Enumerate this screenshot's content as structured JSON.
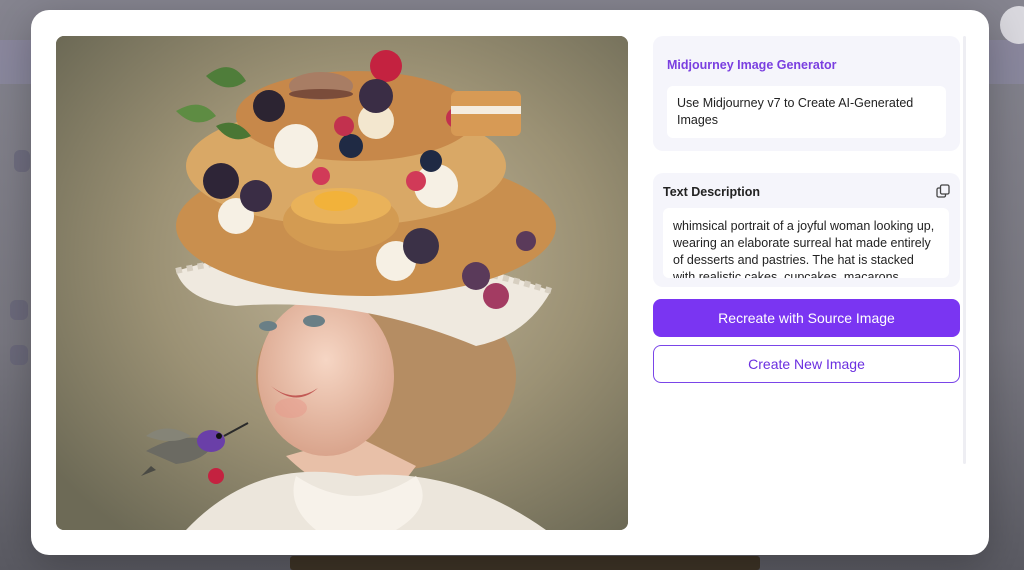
{
  "generator": {
    "title": "Midjourney Image Generator",
    "subtitle": "Use Midjourney v7 to Create AI-Generated Images"
  },
  "description": {
    "label": "Text Description",
    "text": "whimsical portrait of a joyful woman looking up, wearing an elaborate surreal hat made entirely of desserts and pastries. The hat is stacked with realistic cakes, cupcakes, macarons"
  },
  "buttons": {
    "recreate": "Recreate with Source Image",
    "create_new": "Create New Image"
  },
  "icons": {
    "copy": "copy-icon"
  },
  "colors": {
    "accent": "#7a35f2",
    "title_purple": "#7a3fe0"
  }
}
